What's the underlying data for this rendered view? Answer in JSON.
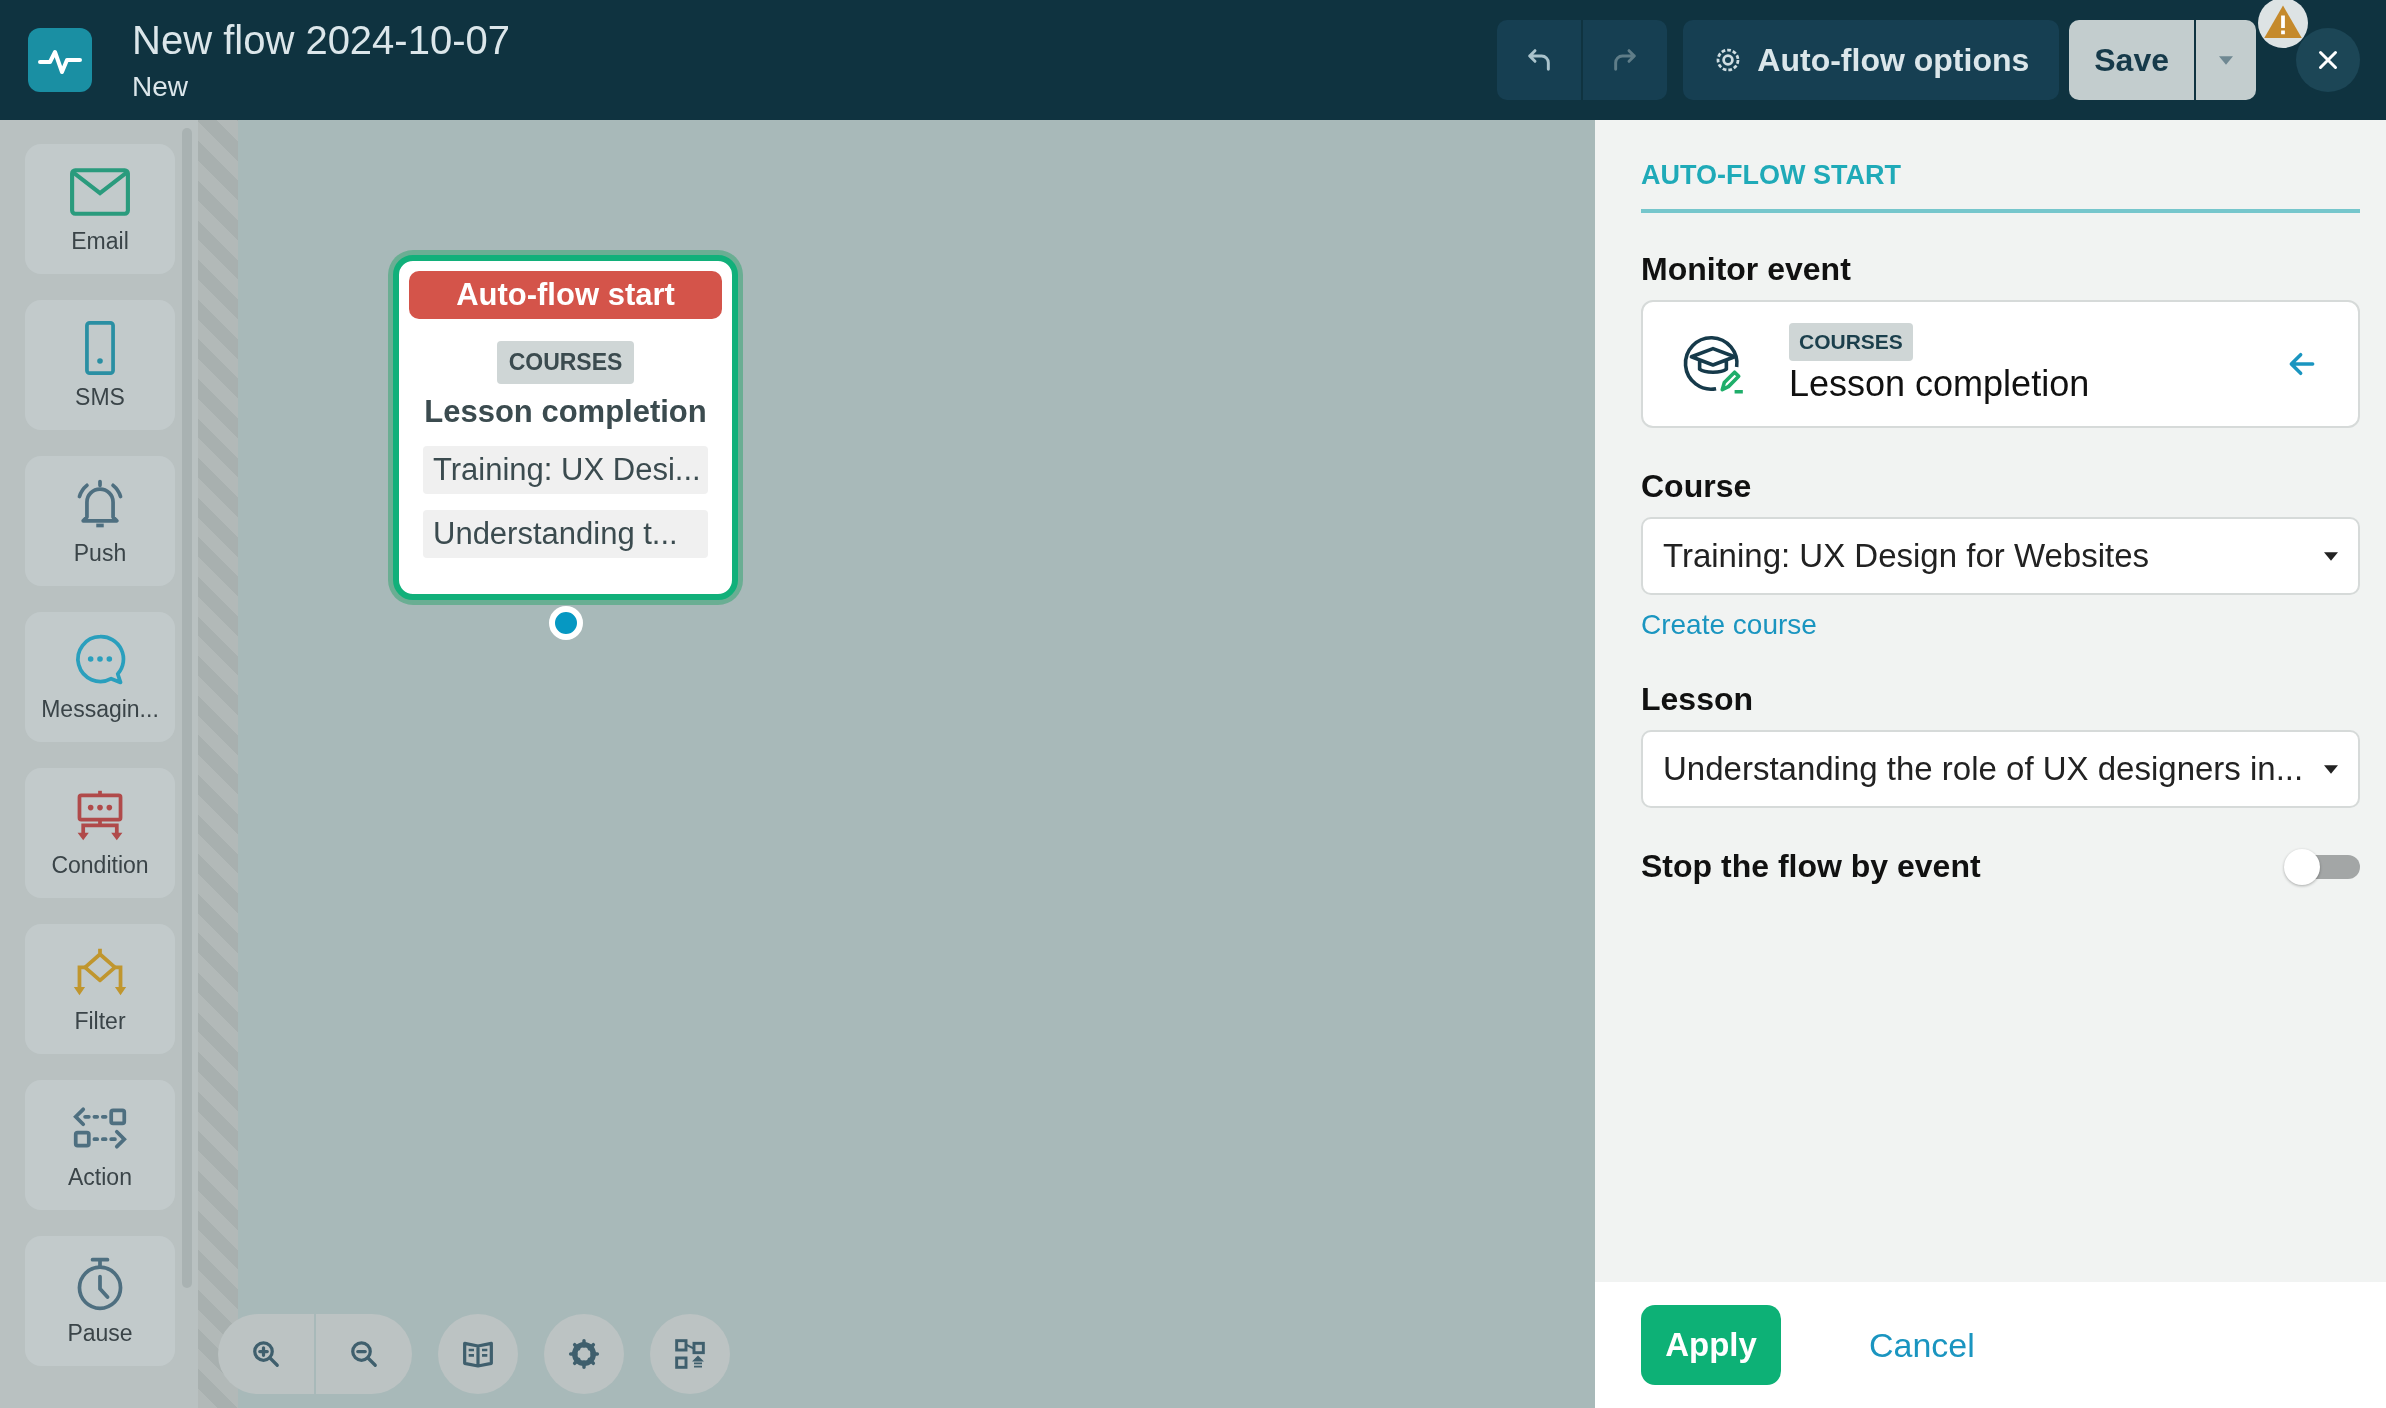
{
  "header": {
    "title": "New flow 2024-10-07",
    "subtitle": "New",
    "options_label": "Auto-flow options",
    "save_label": "Save",
    "warning": true
  },
  "palette": [
    {
      "kind": "email",
      "label": "Email"
    },
    {
      "kind": "sms",
      "label": "SMS"
    },
    {
      "kind": "push",
      "label": "Push"
    },
    {
      "kind": "messaging",
      "label": "Messagin..."
    },
    {
      "kind": "condition",
      "label": "Condition"
    },
    {
      "kind": "filter",
      "label": "Filter"
    },
    {
      "kind": "action",
      "label": "Action"
    },
    {
      "kind": "pause",
      "label": "Pause"
    }
  ],
  "node": {
    "title": "Auto-flow start",
    "category": "COURSES",
    "event": "Lesson completion",
    "params": [
      "Training: UX Desi...",
      "Understanding t..."
    ],
    "selected": true
  },
  "panel": {
    "heading": "AUTO-FLOW START",
    "monitor_event": {
      "label": "Monitor event",
      "category": "COURSES",
      "event": "Lesson completion"
    },
    "course": {
      "label": "Course",
      "value": "Training: UX Design for Websites",
      "link": "Create course"
    },
    "lesson": {
      "label": "Lesson",
      "value": "Understanding the role of UX designers in..."
    },
    "stop_by_event": {
      "label": "Stop the flow by event",
      "on": false
    },
    "apply": "Apply",
    "cancel": "Cancel"
  }
}
